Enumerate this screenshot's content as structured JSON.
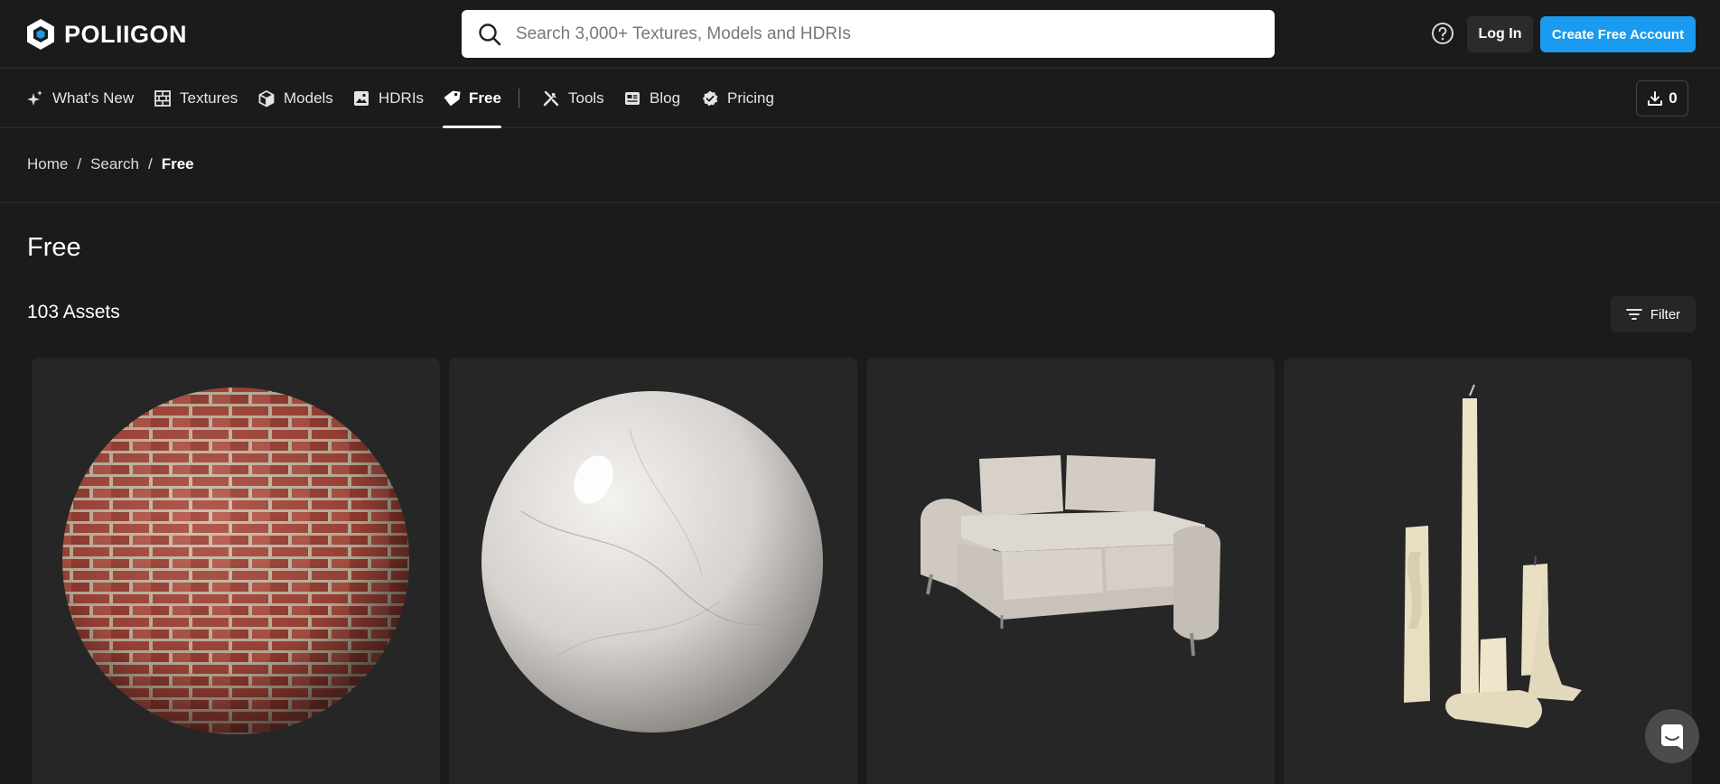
{
  "header": {
    "brand": "POLIIGON",
    "search_placeholder": "Search 3,000+ Textures, Models and HDRIs",
    "login_label": "Log In",
    "signup_label": "Create Free Account",
    "signup_color": "#1a9bef",
    "help_icon": "question-circle-icon"
  },
  "nav": {
    "items": [
      {
        "label": "What's New",
        "icon": "sparkle-icon"
      },
      {
        "label": "Textures",
        "icon": "brick-grid-icon"
      },
      {
        "label": "Models",
        "icon": "cube-icon"
      },
      {
        "label": "HDRIs",
        "icon": "image-icon"
      },
      {
        "label": "Free",
        "icon": "tag-icon",
        "active": true
      },
      {
        "label": "Tools",
        "icon": "tools-icon"
      },
      {
        "label": "Blog",
        "icon": "newspaper-icon"
      },
      {
        "label": "Pricing",
        "icon": "badge-check-icon"
      }
    ],
    "cart_count": "0"
  },
  "breadcrumb": {
    "items": [
      "Home",
      "Search",
      "Free"
    ],
    "separator": "/"
  },
  "page": {
    "title": "Free",
    "asset_count": "103 Assets",
    "filter_label": "Filter"
  },
  "assets": [
    {
      "kind": "texture",
      "subject": "red-brick-sphere"
    },
    {
      "kind": "texture",
      "subject": "marble-sphere"
    },
    {
      "kind": "model",
      "subject": "sofa"
    },
    {
      "kind": "model",
      "subject": "candles"
    }
  ]
}
